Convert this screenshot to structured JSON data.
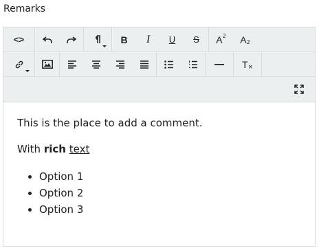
{
  "field_label": "Remarks",
  "toolbar": {
    "row1": [
      {
        "name": "code-view-icon",
        "text": "<>"
      },
      {
        "name": "undo-icon"
      },
      {
        "name": "redo-icon"
      },
      {
        "name": "paragraph-icon"
      },
      {
        "name": "bold-icon",
        "text": "B"
      },
      {
        "name": "italic-icon",
        "text": "I"
      },
      {
        "name": "underline-icon",
        "text": "U"
      },
      {
        "name": "strikethrough-icon",
        "text": "S"
      },
      {
        "name": "superscript-icon",
        "text": "A"
      },
      {
        "name": "subscript-icon",
        "text": "A"
      }
    ],
    "row2": [
      {
        "name": "link-icon"
      },
      {
        "name": "image-icon"
      },
      {
        "name": "align-left-icon"
      },
      {
        "name": "align-center-icon"
      },
      {
        "name": "align-right-icon"
      },
      {
        "name": "align-justify-icon"
      },
      {
        "name": "bullet-list-icon"
      },
      {
        "name": "numbered-list-icon"
      },
      {
        "name": "horizontal-rule-icon"
      },
      {
        "name": "clear-format-icon",
        "text": "T"
      }
    ],
    "row3": [
      {
        "name": "fullscreen-icon"
      }
    ]
  },
  "content": {
    "paragraph1": "This is the place to add a comment.",
    "paragraph2_prefix": "With ",
    "paragraph2_bold": "rich",
    "paragraph2_underlined": "text",
    "list_items": [
      "Option 1",
      "Option 2",
      "Option 3"
    ]
  }
}
